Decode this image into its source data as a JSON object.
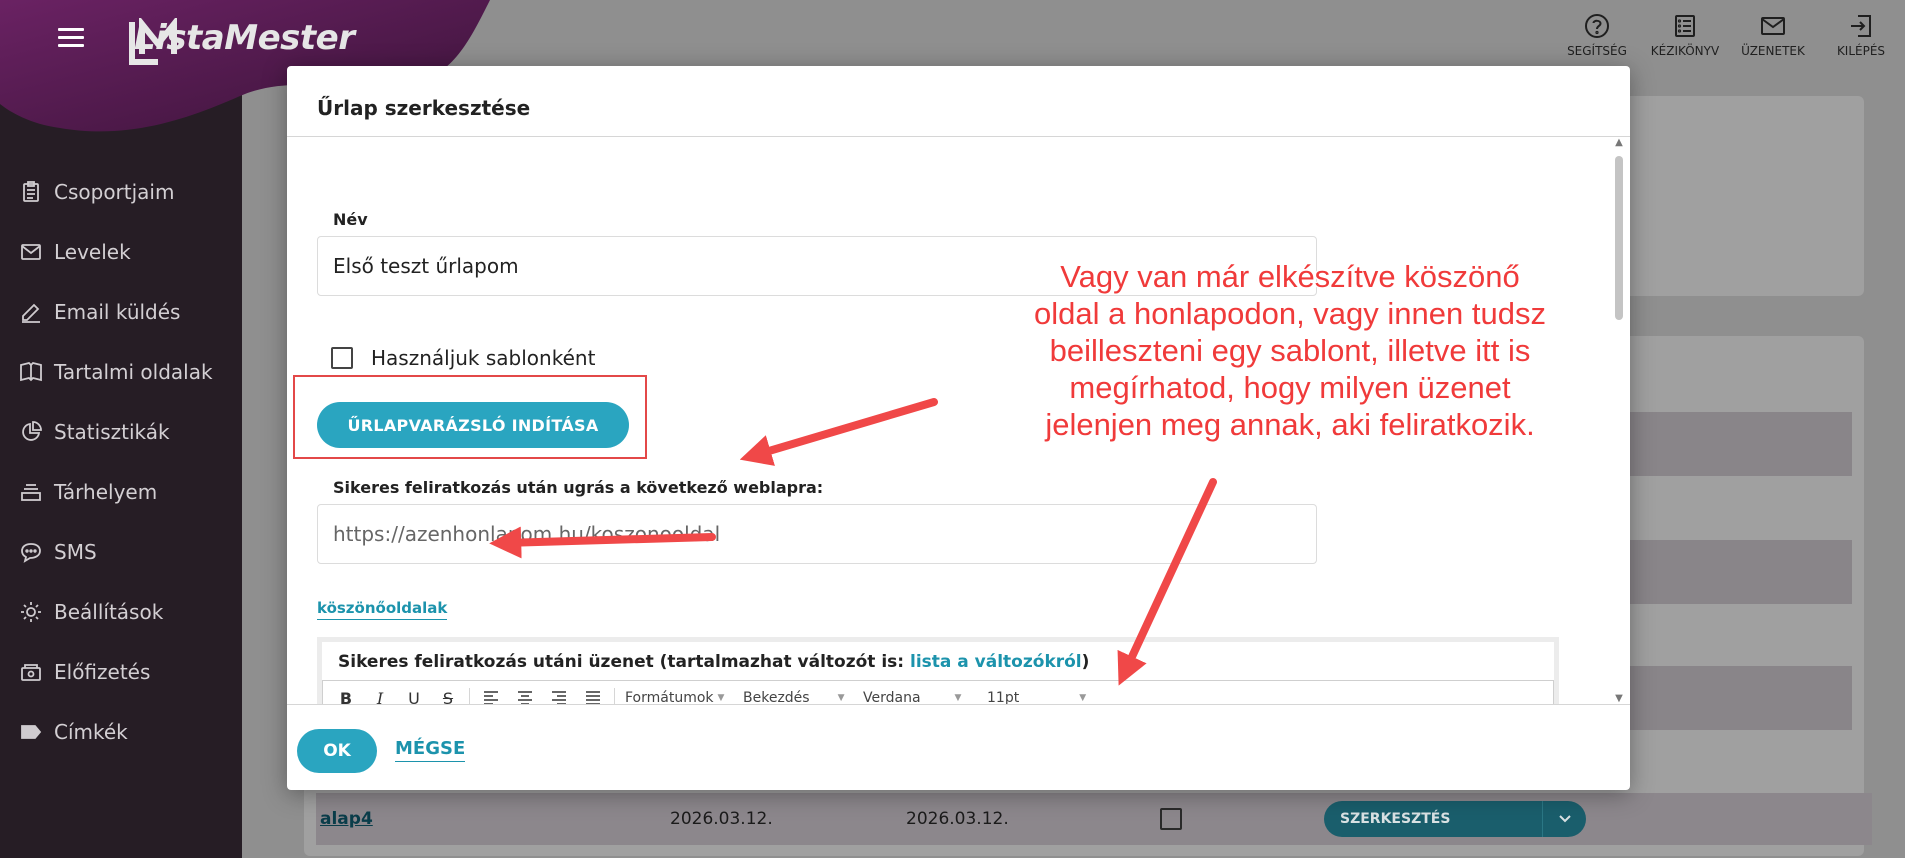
{
  "app": {
    "brand": "ListaMester"
  },
  "topbar": {
    "items": [
      {
        "label": "SEGÍTSÉG",
        "icon": "help-icon"
      },
      {
        "label": "KÉZIKÖNYV",
        "icon": "manual-icon"
      },
      {
        "label": "ÜZENETEK",
        "icon": "mail-icon"
      },
      {
        "label": "KILÉPÉS",
        "icon": "logout-icon"
      }
    ]
  },
  "sidebar": {
    "items": [
      {
        "label": "Csoportjaim",
        "icon": "clipboard-icon"
      },
      {
        "label": "Levelek",
        "icon": "envelope-icon"
      },
      {
        "label": "Email küldés",
        "icon": "pen-icon"
      },
      {
        "label": "Tartalmi oldalak",
        "icon": "book-icon"
      },
      {
        "label": "Statisztikák",
        "icon": "pie-chart-icon"
      },
      {
        "label": "Tárhelyem",
        "icon": "storage-icon"
      },
      {
        "label": "SMS",
        "icon": "chat-icon"
      },
      {
        "label": "Beállítások",
        "icon": "gear-icon"
      },
      {
        "label": "Előfizetés",
        "icon": "subscription-icon"
      },
      {
        "label": "Címkék",
        "icon": "tag-icon"
      }
    ]
  },
  "background_row": {
    "name": "alap4",
    "date1": "2026.03.12.",
    "date2": "2026.03.12.",
    "edit_label": "SZERKESZTÉS"
  },
  "modal": {
    "title": "Űrlap szerkesztése",
    "name_label": "Név",
    "name_value": "Első teszt űrlapom",
    "template_checkbox_label": "Használjuk sablonként",
    "wizard_button": "ŰRLAPVARÁZSLÓ INDÍTÁSA",
    "redirect_label": "Sikeres feliratkozás után ugrás a következő weblapra:",
    "redirect_value": "https://azenhonlapom.hu/koszonooldal",
    "thanks_link": "köszönőoldalak",
    "editor_label": "Sikeres feliratkozás utáni üzenet (tartalmazhat változót is:",
    "editor_link": "lista a változókról",
    "editor_label_close": ")",
    "toolbar": {
      "formats": "Formátumok",
      "block": "Bekezdés",
      "font": "Verdana",
      "size": "11pt"
    },
    "ok_button": "OK",
    "cancel_button": "MÉGSE"
  },
  "annotation": {
    "lines": [
      "Vagy van már elkészítve köszönő",
      "oldal a honlapodon, vagy innen tudsz",
      "beilleszteni egy sablont, illetve itt is",
      "megírhatod, hogy milyen üzenet",
      "jelenjen meg annak, aki feliratkozik."
    ],
    "color": "#f03a3a"
  },
  "colors": {
    "accent": "#2aa5c0",
    "sidebar": "#261d25",
    "brand_purple": "#5a1e5a",
    "highlight": "#e34848"
  }
}
